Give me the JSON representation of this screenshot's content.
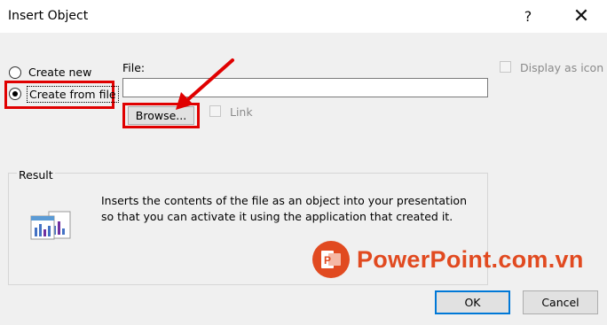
{
  "dialog": {
    "title": "Insert Object",
    "help_glyph": "?",
    "close_glyph": "✕"
  },
  "options": {
    "create_new": "Create new",
    "create_from_file": "Create from file"
  },
  "file": {
    "label": "File:",
    "value": "",
    "browse_label": "Browse...",
    "link_label": "Link"
  },
  "display_as_icon": "Display as icon",
  "result": {
    "title": "Result",
    "text": "Inserts the contents of the file as an object into your presentation so that you can activate it using the application that created it."
  },
  "watermark": {
    "text": "PowerPoint.com.vn",
    "color": "#e14a20"
  },
  "buttons": {
    "ok": "OK",
    "cancel": "Cancel"
  },
  "icons": [
    "help-icon",
    "close-icon",
    "result-object-icon",
    "powerpoint-logo-icon",
    "red-arrow-annotation"
  ],
  "colors": {
    "highlight": "#e00000",
    "accent": "#0078d7"
  }
}
